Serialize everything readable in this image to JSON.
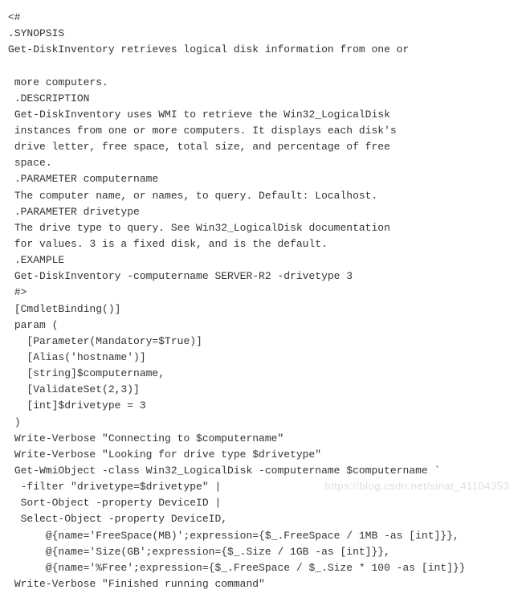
{
  "code": {
    "l1": "<#",
    "l2": ".SYNOPSIS",
    "l3": "Get-DiskInventory retrieves logical disk information from one or",
    "l4": "",
    "l5": " more computers.",
    "l6": " .DESCRIPTION",
    "l7": " Get-DiskInventory uses WMI to retrieve the Win32_LogicalDisk",
    "l8": " instances from one or more computers. It displays each disk's",
    "l9": " drive letter, free space, total size, and percentage of free",
    "l10": " space.",
    "l11": " .PARAMETER computername",
    "l12": " The computer name, or names, to query. Default: Localhost.",
    "l13": " .PARAMETER drivetype",
    "l14": " The drive type to query. See Win32_LogicalDisk documentation",
    "l15": " for values. 3 is a fixed disk, and is the default.",
    "l16": " .EXAMPLE",
    "l17": " Get-DiskInventory -computername SERVER-R2 -drivetype 3",
    "l18": " #>",
    "l19": " [CmdletBinding()]",
    "l20": " param (",
    "l21": "   [Parameter(Mandatory=$True)]",
    "l22": "   [Alias('hostname')]",
    "l23": "   [string]$computername,",
    "l24": "   [ValidateSet(2,3)]",
    "l25": "   [int]$drivetype = 3",
    "l26": " )",
    "l27": " Write-Verbose \"Connecting to $computername\"",
    "l28": " Write-Verbose \"Looking for drive type $drivetype\"",
    "l29": " Get-WmiObject -class Win32_LogicalDisk -computername $computername `",
    "l30": "  -filter \"drivetype=$drivetype\" |",
    "l31": "  Sort-Object -property DeviceID |",
    "l32": "  Select-Object -property DeviceID,",
    "l33": "      @{name='FreeSpace(MB)';expression={$_.FreeSpace / 1MB -as [int]}},",
    "l34": "      @{name='Size(GB';expression={$_.Size / 1GB -as [int]}},",
    "l35": "      @{name='%Free';expression={$_.FreeSpace / $_.Size * 100 -as [int]}}",
    "l36": " Write-Verbose \"Finished running command\""
  },
  "watermark": "https://blog.csdn.net/sinat_41104353"
}
